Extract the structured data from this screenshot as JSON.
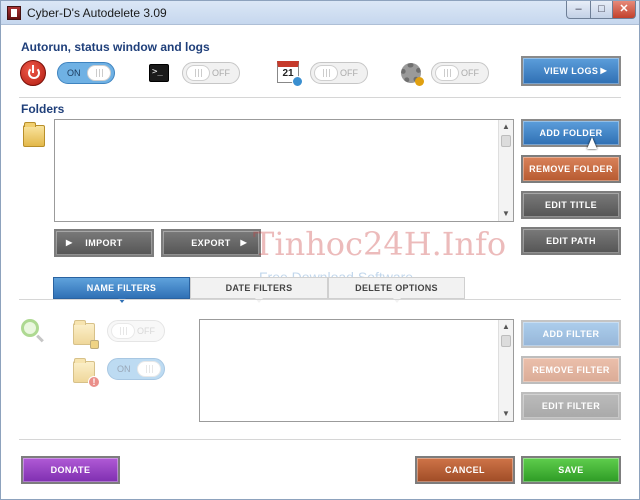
{
  "window": {
    "title": "Cyber-D's Autodelete 3.09",
    "minimize": "–",
    "maximize": "□",
    "close": "✕"
  },
  "autorun": {
    "heading": "Autorun, status window and logs",
    "toggles": [
      {
        "icon": "power-icon",
        "state": "ON"
      },
      {
        "icon": "terminal-icon",
        "state": "OFF"
      },
      {
        "icon": "calendar-icon",
        "state": "OFF"
      },
      {
        "icon": "gear-icon",
        "state": "OFF"
      }
    ],
    "terminal_glyph": ">_",
    "calendar_day": "21",
    "view_logs": "VIEW LOGS"
  },
  "folders": {
    "heading": "Folders",
    "add": "ADD FOLDER",
    "remove": "REMOVE FOLDER",
    "edit_title": "EDIT TITLE",
    "edit_path": "EDIT PATH",
    "import": "IMPORT",
    "export": "EXPORT",
    "items": []
  },
  "tabs": [
    {
      "label": "NAME FILTERS",
      "active": true
    },
    {
      "label": "DATE FILTERS",
      "active": false
    },
    {
      "label": "DELETE OPTIONS",
      "active": false
    }
  ],
  "filters": {
    "lock_toggle": "OFF",
    "warn_toggle": "ON",
    "warn_glyph": "!",
    "add": "ADD FILTER",
    "remove": "REMOVE FILTER",
    "edit": "EDIT FILTER",
    "items": []
  },
  "footer": {
    "donate": "DONATE",
    "cancel": "CANCEL",
    "save": "SAVE"
  },
  "watermark": {
    "main": "Tinhoc24H.Info",
    "sub": "Free Download Software"
  },
  "colors": {
    "accent": "#2f70b5",
    "heading": "#1f3f7a",
    "orange": "#b75a30",
    "purple": "#7f2fb0",
    "green": "#2e9b25"
  }
}
